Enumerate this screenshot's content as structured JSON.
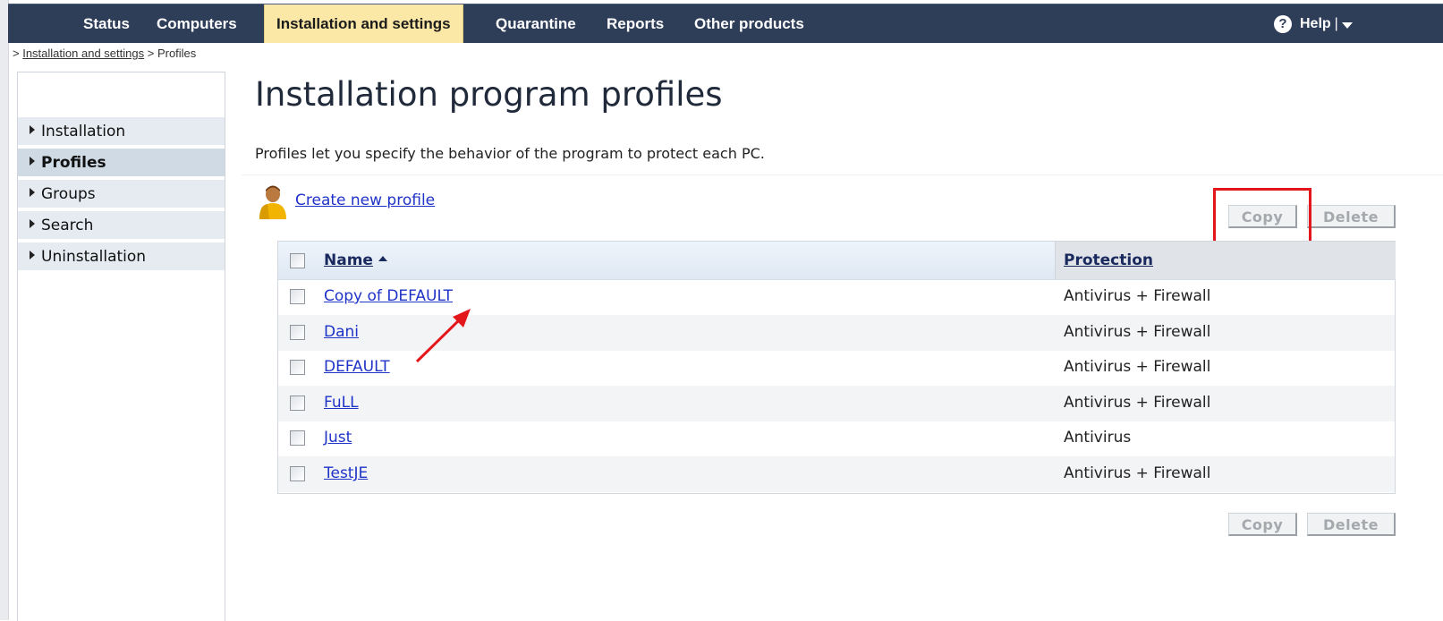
{
  "nav": {
    "items": [
      {
        "label": "Status"
      },
      {
        "label": "Computers"
      },
      {
        "label": "Installation and settings"
      },
      {
        "label": "Quarantine"
      },
      {
        "label": "Reports"
      },
      {
        "label": "Other products"
      }
    ],
    "active_index": 2,
    "help_icon": "?",
    "help_label": "Help",
    "help_separator": "|",
    "colors": {
      "bar": "#2e3d58",
      "active_tab": "#fbe8a6"
    }
  },
  "breadcrumb": {
    "prefix": ">",
    "link": "Installation and settings",
    "separator": ">",
    "current": "Profiles"
  },
  "sidebar": {
    "items": [
      {
        "label": "Installation"
      },
      {
        "label": "Profiles"
      },
      {
        "label": "Groups"
      },
      {
        "label": "Search"
      },
      {
        "label": "Uninstallation"
      }
    ],
    "active_index": 1
  },
  "main": {
    "title": "Installation program profiles",
    "description": "Profiles let you specify the behavior of the program to protect each PC.",
    "create_link": "Create new profile",
    "create_icon": "person-icon",
    "copy_label": "Copy",
    "delete_label": "Delete"
  },
  "table": {
    "columns": {
      "name": "Name",
      "protection": "Protection"
    },
    "sort": {
      "column": "name",
      "direction": "ascending"
    },
    "rows": [
      {
        "name": "Copy of DEFAULT",
        "protection": "Antivirus + Firewall"
      },
      {
        "name": "Dani",
        "protection": "Antivirus + Firewall"
      },
      {
        "name": "DEFAULT",
        "protection": "Antivirus + Firewall"
      },
      {
        "name": "FuLL",
        "protection": "Antivirus + Firewall"
      },
      {
        "name": "Just",
        "protection": "Antivirus"
      },
      {
        "name": "TestJE",
        "protection": "Antivirus + Firewall"
      }
    ]
  },
  "annotation": {
    "color": "#e3171b"
  }
}
